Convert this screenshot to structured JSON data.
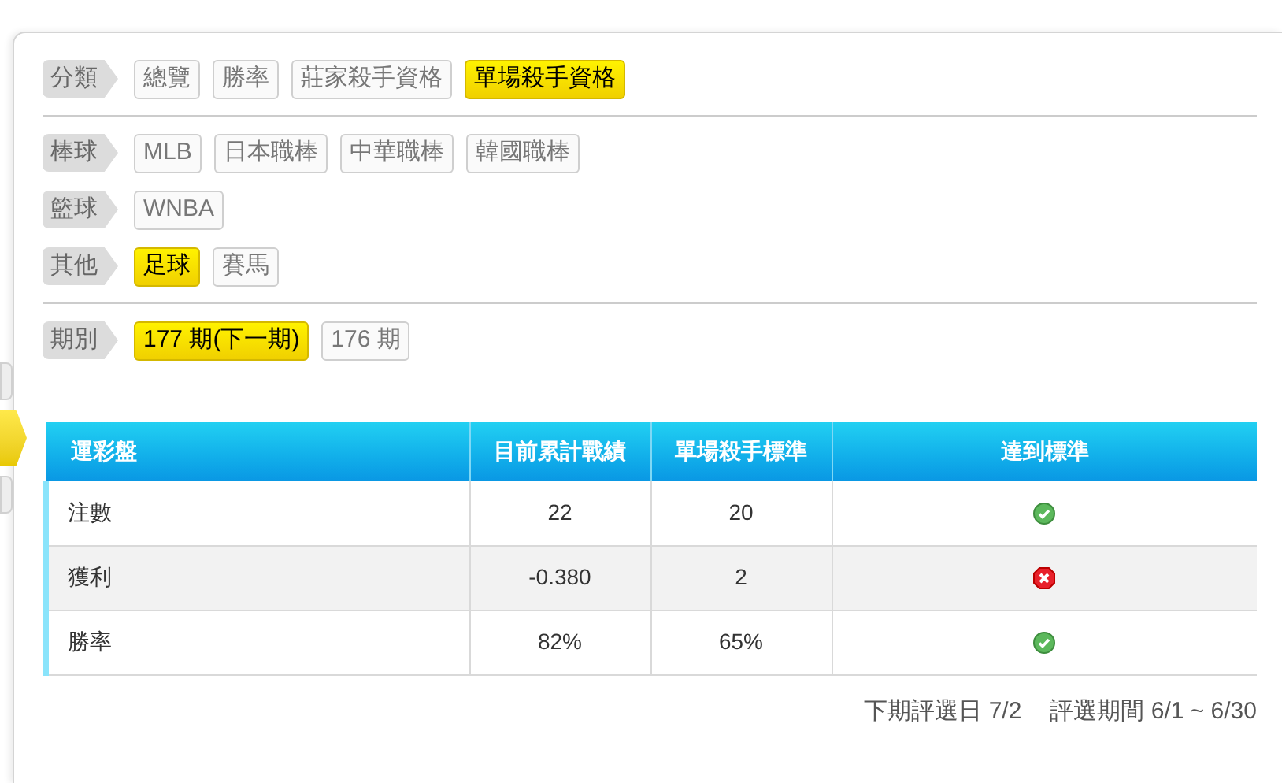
{
  "filter_groups": [
    [
      {
        "label": "分類",
        "options": [
          {
            "label": "總覽",
            "selected": false
          },
          {
            "label": "勝率",
            "selected": false
          },
          {
            "label": "莊家殺手資格",
            "selected": false
          },
          {
            "label": "單場殺手資格",
            "selected": true
          }
        ]
      }
    ],
    [
      {
        "label": "棒球",
        "options": [
          {
            "label": "MLB",
            "selected": false
          },
          {
            "label": "日本職棒",
            "selected": false
          },
          {
            "label": "中華職棒",
            "selected": false
          },
          {
            "label": "韓國職棒",
            "selected": false
          }
        ]
      },
      {
        "label": "籃球",
        "options": [
          {
            "label": "WNBA",
            "selected": false
          }
        ]
      },
      {
        "label": "其他",
        "options": [
          {
            "label": "足球",
            "selected": true
          },
          {
            "label": "賽馬",
            "selected": false
          }
        ]
      }
    ],
    [
      {
        "label": "期別",
        "options": [
          {
            "label": "177 期(下一期)",
            "selected": true
          },
          {
            "label": "176 期",
            "selected": false
          }
        ]
      }
    ]
  ],
  "side_tabs": [
    {
      "selected": false
    },
    {
      "selected": true
    },
    {
      "selected": false
    }
  ],
  "table": {
    "columns": [
      "運彩盤",
      "目前累計戰績",
      "單場殺手標準",
      "達到標準"
    ],
    "rows": [
      {
        "name": "注數",
        "current": "22",
        "standard": "20",
        "met": true
      },
      {
        "name": "獲利",
        "current": "-0.380",
        "standard": "2",
        "met": false
      },
      {
        "name": "勝率",
        "current": "82%",
        "standard": "65%",
        "met": true
      }
    ]
  },
  "footer": {
    "next_date": "下期評選日 7/2",
    "period": "評選期間 6/1 ~ 6/30"
  }
}
